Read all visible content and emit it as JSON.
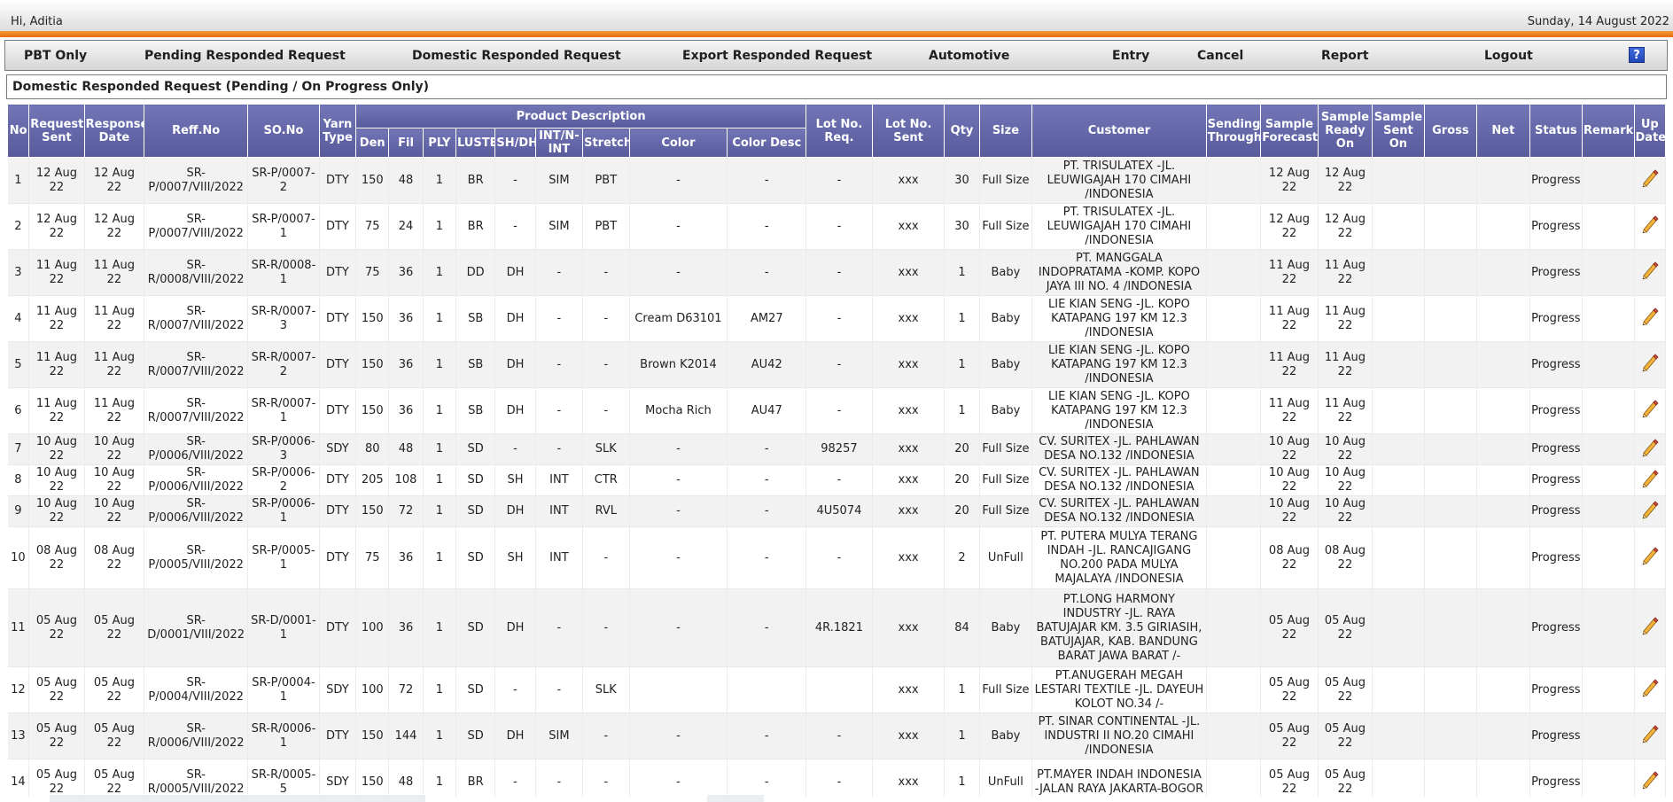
{
  "header": {
    "greeting": "Hi, Aditia",
    "date": "Sunday, 14 August 2022"
  },
  "menu": {
    "items": [
      "PBT Only",
      "Pending Responded Request",
      "Domestic Responded Request",
      "Export Responded Request",
      "Automotive",
      "Entry",
      "Cancel",
      "Report",
      "Logout"
    ],
    "help_label": "?"
  },
  "page": {
    "title": "Domestic Responded Request (Pending / On Progress Only)"
  },
  "table": {
    "group_header": "Product Description",
    "col_no": "No",
    "col_request_sent": "Request Sent",
    "col_response_date": "Response Date",
    "col_reff_no": "Reff.No",
    "col_so_no": "SO.No",
    "col_yarn_type": "Yarn Type",
    "col_den": "Den",
    "col_fil": "Fil",
    "col_ply": "PLY",
    "col_luster": "LUSTER",
    "col_shdh": "SH/DH",
    "col_int": "INT/N-INT",
    "col_stretch": "Stretch",
    "col_color": "Color",
    "col_color_desc": "Color Desc",
    "col_lot_req": "Lot No. Req.",
    "col_lot_sent": "Lot No. Sent",
    "col_qty": "Qty",
    "col_size": "Size",
    "col_customer": "Customer",
    "col_sending": "Sending Through",
    "col_forecast": "Sample Forecast",
    "col_ready": "Sample Ready On",
    "col_sent_on": "Sample Sent On",
    "col_gross": "Gross",
    "col_net": "Net",
    "col_status": "Status",
    "col_remark": "Remark",
    "col_update": "Up Date",
    "rows": [
      {
        "no": "1",
        "req": "12 Aug 22",
        "resp": "12 Aug 22",
        "reff": "SR-P/0007/VIII/2022",
        "so": "SR-P/0007-2",
        "yarn": "DTY",
        "den": "150",
        "fil": "48",
        "ply": "1",
        "luster": "BR",
        "shdh": "-",
        "int": "SIM",
        "stretch": "PBT",
        "color": "-",
        "colordesc": "-",
        "lotreq": "-",
        "lotsent": "xxx",
        "qty": "30",
        "size": "Full Size",
        "customer": "PT. TRISULATEX -JL. LEUWIGAJAH 170 CIMAHI /INDONESIA",
        "sending": "",
        "forecast": "12 Aug 22",
        "ready": "12 Aug 22",
        "senton": "",
        "gross": "",
        "net": "",
        "status": "Progress",
        "remark": ""
      },
      {
        "no": "2",
        "req": "12 Aug 22",
        "resp": "12 Aug 22",
        "reff": "SR-P/0007/VIII/2022",
        "so": "SR-P/0007-1",
        "yarn": "DTY",
        "den": "75",
        "fil": "24",
        "ply": "1",
        "luster": "BR",
        "shdh": "-",
        "int": "SIM",
        "stretch": "PBT",
        "color": "-",
        "colordesc": "-",
        "lotreq": "-",
        "lotsent": "xxx",
        "qty": "30",
        "size": "Full Size",
        "customer": "PT. TRISULATEX -JL. LEUWIGAJAH 170 CIMAHI /INDONESIA",
        "sending": "",
        "forecast": "12 Aug 22",
        "ready": "12 Aug 22",
        "senton": "",
        "gross": "",
        "net": "",
        "status": "Progress",
        "remark": ""
      },
      {
        "no": "3",
        "req": "11 Aug 22",
        "resp": "11 Aug 22",
        "reff": "SR-R/0008/VIII/2022",
        "so": "SR-R/0008-1",
        "yarn": "DTY",
        "den": "75",
        "fil": "36",
        "ply": "1",
        "luster": "DD",
        "shdh": "DH",
        "int": "-",
        "stretch": "-",
        "color": "-",
        "colordesc": "-",
        "lotreq": "-",
        "lotsent": "xxx",
        "qty": "1",
        "size": "Baby",
        "customer": "PT. MANGGALA INDOPRATAMA -KOMP. KOPO JAYA III NO. 4 /INDONESIA",
        "sending": "",
        "forecast": "11 Aug 22",
        "ready": "11 Aug 22",
        "senton": "",
        "gross": "",
        "net": "",
        "status": "Progress",
        "remark": ""
      },
      {
        "no": "4",
        "req": "11 Aug 22",
        "resp": "11 Aug 22",
        "reff": "SR-R/0007/VIII/2022",
        "so": "SR-R/0007-3",
        "yarn": "DTY",
        "den": "150",
        "fil": "36",
        "ply": "1",
        "luster": "SB",
        "shdh": "DH",
        "int": "-",
        "stretch": "-",
        "color": "Cream D63101",
        "colordesc": "AM27",
        "lotreq": "-",
        "lotsent": "xxx",
        "qty": "1",
        "size": "Baby",
        "customer": "LIE KIAN SENG -JL. KOPO KATAPANG 197 KM 12.3 /INDONESIA",
        "sending": "",
        "forecast": "11 Aug 22",
        "ready": "11 Aug 22",
        "senton": "",
        "gross": "",
        "net": "",
        "status": "Progress",
        "remark": ""
      },
      {
        "no": "5",
        "req": "11 Aug 22",
        "resp": "11 Aug 22",
        "reff": "SR-R/0007/VIII/2022",
        "so": "SR-R/0007-2",
        "yarn": "DTY",
        "den": "150",
        "fil": "36",
        "ply": "1",
        "luster": "SB",
        "shdh": "DH",
        "int": "-",
        "stretch": "-",
        "color": "Brown K2014",
        "colordesc": "AU42",
        "lotreq": "-",
        "lotsent": "xxx",
        "qty": "1",
        "size": "Baby",
        "customer": "LIE KIAN SENG -JL. KOPO KATAPANG 197 KM 12.3 /INDONESIA",
        "sending": "",
        "forecast": "11 Aug 22",
        "ready": "11 Aug 22",
        "senton": "",
        "gross": "",
        "net": "",
        "status": "Progress",
        "remark": ""
      },
      {
        "no": "6",
        "req": "11 Aug 22",
        "resp": "11 Aug 22",
        "reff": "SR-R/0007/VIII/2022",
        "so": "SR-R/0007-1",
        "yarn": "DTY",
        "den": "150",
        "fil": "36",
        "ply": "1",
        "luster": "SB",
        "shdh": "DH",
        "int": "-",
        "stretch": "-",
        "color": "Mocha Rich",
        "colordesc": "AU47",
        "lotreq": "-",
        "lotsent": "xxx",
        "qty": "1",
        "size": "Baby",
        "customer": "LIE KIAN SENG -JL. KOPO KATAPANG 197 KM 12.3 /INDONESIA",
        "sending": "",
        "forecast": "11 Aug 22",
        "ready": "11 Aug 22",
        "senton": "",
        "gross": "",
        "net": "",
        "status": "Progress",
        "remark": ""
      },
      {
        "no": "7",
        "req": "10 Aug 22",
        "resp": "10 Aug 22",
        "reff": "SR-P/0006/VIII/2022",
        "so": "SR-P/0006-3",
        "yarn": "SDY",
        "den": "80",
        "fil": "48",
        "ply": "1",
        "luster": "SD",
        "shdh": "-",
        "int": "-",
        "stretch": "SLK",
        "color": "-",
        "colordesc": "-",
        "lotreq": "98257",
        "lotsent": "xxx",
        "qty": "20",
        "size": "Full Size",
        "customer": "CV. SURITEX -JL. PAHLAWAN DESA NO.132 /INDONESIA",
        "sending": "",
        "forecast": "10 Aug 22",
        "ready": "10 Aug 22",
        "senton": "",
        "gross": "",
        "net": "",
        "status": "Progress",
        "remark": ""
      },
      {
        "no": "8",
        "req": "10 Aug 22",
        "resp": "10 Aug 22",
        "reff": "SR-P/0006/VIII/2022",
        "so": "SR-P/0006-2",
        "yarn": "DTY",
        "den": "205",
        "fil": "108",
        "ply": "1",
        "luster": "SD",
        "shdh": "SH",
        "int": "INT",
        "stretch": "CTR",
        "color": "-",
        "colordesc": "-",
        "lotreq": "-",
        "lotsent": "xxx",
        "qty": "20",
        "size": "Full Size",
        "customer": "CV. SURITEX -JL. PAHLAWAN DESA NO.132 /INDONESIA",
        "sending": "",
        "forecast": "10 Aug 22",
        "ready": "10 Aug 22",
        "senton": "",
        "gross": "",
        "net": "",
        "status": "Progress",
        "remark": ""
      },
      {
        "no": "9",
        "req": "10 Aug 22",
        "resp": "10 Aug 22",
        "reff": "SR-P/0006/VIII/2022",
        "so": "SR-P/0006-1",
        "yarn": "DTY",
        "den": "150",
        "fil": "72",
        "ply": "1",
        "luster": "SD",
        "shdh": "DH",
        "int": "INT",
        "stretch": "RVL",
        "color": "-",
        "colordesc": "-",
        "lotreq": "4U5074",
        "lotsent": "xxx",
        "qty": "20",
        "size": "Full Size",
        "customer": "CV. SURITEX -JL. PAHLAWAN DESA NO.132 /INDONESIA",
        "sending": "",
        "forecast": "10 Aug 22",
        "ready": "10 Aug 22",
        "senton": "",
        "gross": "",
        "net": "",
        "status": "Progress",
        "remark": ""
      },
      {
        "no": "10",
        "req": "08 Aug 22",
        "resp": "08 Aug 22",
        "reff": "SR-P/0005/VIII/2022",
        "so": "SR-P/0005-1",
        "yarn": "DTY",
        "den": "75",
        "fil": "36",
        "ply": "1",
        "luster": "SD",
        "shdh": "SH",
        "int": "INT",
        "stretch": "-",
        "color": "-",
        "colordesc": "-",
        "lotreq": "-",
        "lotsent": "xxx",
        "qty": "2",
        "size": "UnFull",
        "customer": "PT. PUTERA MULYA TERANG INDAH -JL. RANCAJIGANG NO.200 PADA MULYA MAJALAYA /INDONESIA",
        "sending": "",
        "forecast": "08 Aug 22",
        "ready": "08 Aug 22",
        "senton": "",
        "gross": "",
        "net": "",
        "status": "Progress",
        "remark": ""
      },
      {
        "no": "11",
        "req": "05 Aug 22",
        "resp": "05 Aug 22",
        "reff": "SR-D/0001/VIII/2022",
        "so": "SR-D/0001-1",
        "yarn": "DTY",
        "den": "100",
        "fil": "36",
        "ply": "1",
        "luster": "SD",
        "shdh": "DH",
        "int": "-",
        "stretch": "-",
        "color": "-",
        "colordesc": "-",
        "lotreq": "4R.1821",
        "lotsent": "xxx",
        "qty": "84",
        "size": "Baby",
        "customer": "PT.LONG HARMONY INDUSTRY -JL. RAYA BATUJAJAR KM. 3.5 GIRIASIH, BATUJAJAR, KAB. BANDUNG BARAT JAWA BARAT /-",
        "sending": "",
        "forecast": "05 Aug 22",
        "ready": "05 Aug 22",
        "senton": "",
        "gross": "",
        "net": "",
        "status": "Progress",
        "remark": ""
      },
      {
        "no": "12",
        "req": "05 Aug 22",
        "resp": "05 Aug 22",
        "reff": "SR-P/0004/VIII/2022",
        "so": "SR-P/0004-1",
        "yarn": "SDY",
        "den": "100",
        "fil": "72",
        "ply": "1",
        "luster": "SD",
        "shdh": "-",
        "int": "-",
        "stretch": "SLK",
        "color": "",
        "colordesc": "",
        "lotreq": "",
        "lotsent": "xxx",
        "qty": "1",
        "size": "Full Size",
        "customer": "PT.ANUGERAH MEGAH LESTARI TEXTILE -JL. DAYEUH KOLOT NO.34 /-",
        "sending": "",
        "forecast": "05 Aug 22",
        "ready": "05 Aug 22",
        "senton": "",
        "gross": "",
        "net": "",
        "status": "Progress",
        "remark": ""
      },
      {
        "no": "13",
        "req": "05 Aug 22",
        "resp": "05 Aug 22",
        "reff": "SR-R/0006/VIII/2022",
        "so": "SR-R/0006-1",
        "yarn": "DTY",
        "den": "150",
        "fil": "144",
        "ply": "1",
        "luster": "SD",
        "shdh": "DH",
        "int": "SIM",
        "stretch": "-",
        "color": "-",
        "colordesc": "-",
        "lotreq": "-",
        "lotsent": "xxx",
        "qty": "1",
        "size": "Baby",
        "customer": "PT. SINAR CONTINENTAL -JL. INDUSTRI II NO.20 CIMAHI /INDONESIA",
        "sending": "",
        "forecast": "05 Aug 22",
        "ready": "05 Aug 22",
        "senton": "",
        "gross": "",
        "net": "",
        "status": "Progress",
        "remark": ""
      },
      {
        "no": "14",
        "req": "05 Aug 22",
        "resp": "05 Aug 22",
        "reff": "SR-R/0005/VIII/2022",
        "so": "SR-R/0005-5",
        "yarn": "SDY",
        "den": "150",
        "fil": "48",
        "ply": "1",
        "luster": "BR",
        "shdh": "-",
        "int": "-",
        "stretch": "-",
        "color": "-",
        "colordesc": "-",
        "lotreq": "-",
        "lotsent": "xxx",
        "qty": "1",
        "size": "UnFull",
        "customer": "PT.MAYER INDAH INDONESIA -JALAN RAYA JAKARTA-BOGOR",
        "sending": "",
        "forecast": "05 Aug 22",
        "ready": "05 Aug 22",
        "senton": "",
        "gross": "",
        "net": "",
        "status": "Progress",
        "remark": ""
      }
    ]
  }
}
